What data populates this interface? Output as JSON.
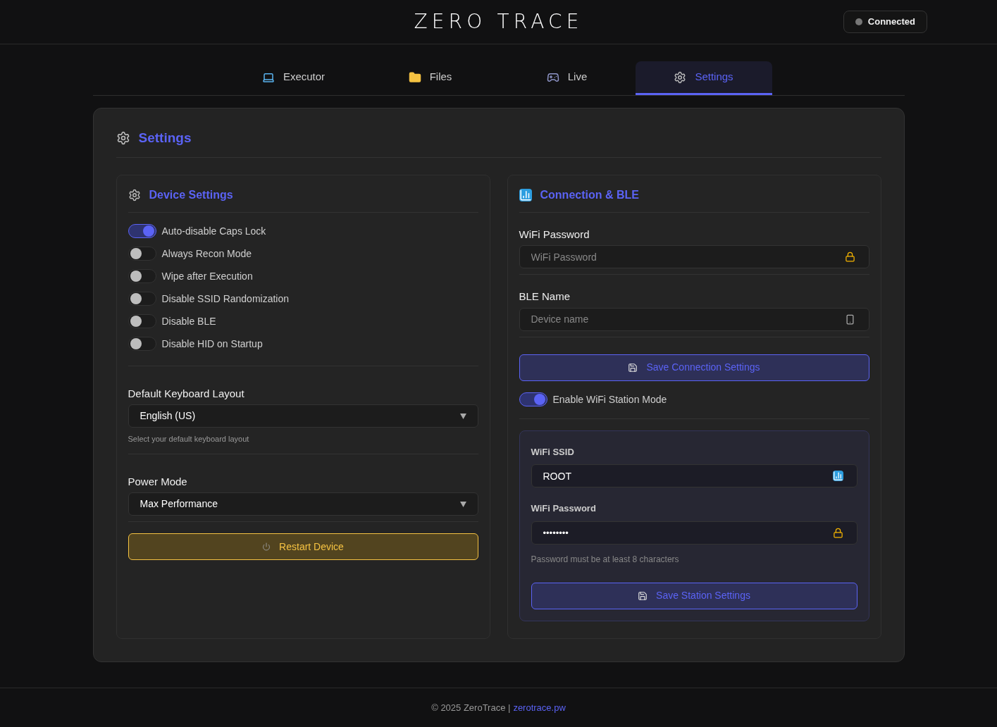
{
  "header": {
    "logo": "ZERO TRACE",
    "status": "Connected"
  },
  "tabs": [
    {
      "label": "Executor",
      "selected": false
    },
    {
      "label": "Files",
      "selected": false
    },
    {
      "label": "Live",
      "selected": false
    },
    {
      "label": "Settings",
      "selected": true
    }
  ],
  "page_title": "Settings",
  "device_settings": {
    "title": "Device Settings",
    "toggles": [
      {
        "label": "Auto-disable Caps Lock",
        "on": true
      },
      {
        "label": "Always Recon Mode",
        "on": false
      },
      {
        "label": "Wipe after Execution",
        "on": false
      },
      {
        "label": "Disable SSID Randomization",
        "on": false
      },
      {
        "label": "Disable BLE",
        "on": false
      },
      {
        "label": "Disable HID on Startup",
        "on": false
      }
    ],
    "keyboard_layout": {
      "label": "Default Keyboard Layout",
      "value": "English (US)",
      "hint": "Select your default keyboard layout"
    },
    "power_mode": {
      "label": "Power Mode",
      "value": "Max Performance"
    },
    "restart_button": "Restart Device"
  },
  "connection": {
    "title": "Connection & BLE",
    "wifi_password": {
      "label": "WiFi Password",
      "placeholder": "WiFi Password"
    },
    "ble_name": {
      "label": "BLE Name",
      "placeholder": "Device name"
    },
    "save_button": "Save Connection Settings",
    "station_toggle": {
      "label": "Enable WiFi Station Mode",
      "on": true
    },
    "station": {
      "ssid": {
        "label": "WiFi SSID",
        "value": "ROOT"
      },
      "password": {
        "label": "WiFi Password",
        "value": "••••••••",
        "hint": "Password must be at least 8 characters"
      },
      "save_button": "Save Station Settings"
    }
  },
  "footer": {
    "text": "© 2025 ZeroTrace |",
    "link": "zerotrace.pw"
  }
}
